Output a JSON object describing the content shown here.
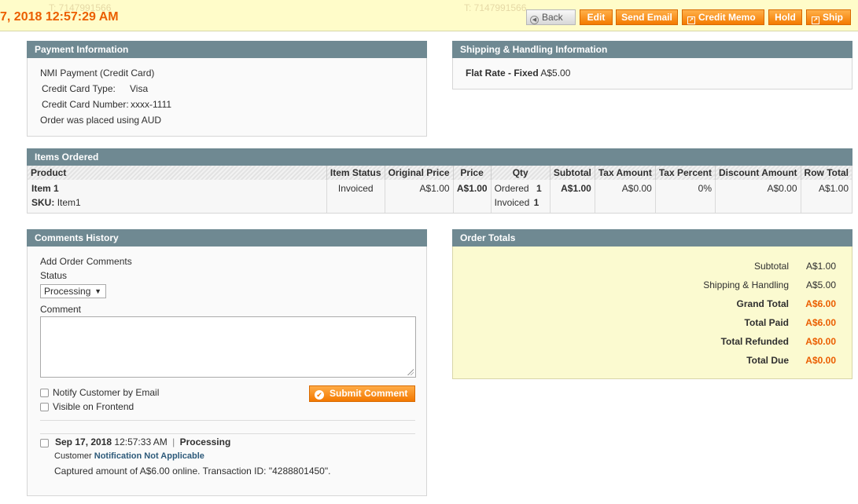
{
  "header": {
    "ghost_phone_left": "T: 7147991566",
    "ghost_phone_right": "T: 7147991566",
    "title": "7, 2018 12:57:29 AM",
    "buttons": {
      "back": "Back",
      "edit": "Edit",
      "send_email": "Send Email",
      "credit_memo": "Credit Memo",
      "hold": "Hold",
      "ship": "Ship"
    }
  },
  "payment": {
    "title": "Payment Information",
    "method": "NMI Payment (Credit Card)",
    "card_type_label": "Credit Card Type:",
    "card_type_value": "Visa",
    "card_number_label": "Credit Card Number:",
    "card_number_value": "xxxx-1111",
    "currency_note": "Order was placed using AUD"
  },
  "shipping": {
    "title": "Shipping & Handling Information",
    "method": "Flat Rate - Fixed",
    "amount": "A$5.00"
  },
  "items": {
    "title": "Items Ordered",
    "columns": [
      "Product",
      "Item Status",
      "Original Price",
      "Price",
      "Qty",
      "Subtotal",
      "Tax Amount",
      "Tax Percent",
      "Discount Amount",
      "Row Total"
    ],
    "rows": [
      {
        "name": "Item 1",
        "sku_label": "SKU:",
        "sku": "Item1",
        "status": "Invoiced",
        "original_price": "A$1.00",
        "price": "A$1.00",
        "qty_ordered_label": "Ordered",
        "qty_ordered": "1",
        "qty_invoiced_label": "Invoiced",
        "qty_invoiced": "1",
        "subtotal": "A$1.00",
        "tax_amount": "A$0.00",
        "tax_percent": "0%",
        "discount": "A$0.00",
        "row_total": "A$1.00"
      }
    ]
  },
  "comments": {
    "title": "Comments History",
    "add_label": "Add Order Comments",
    "status_label": "Status",
    "status_value": "Processing",
    "comment_label": "Comment",
    "notify_label": "Notify Customer by Email",
    "visible_label": "Visible on Frontend",
    "submit_label": "Submit Comment",
    "history": [
      {
        "date": "Sep 17, 2018",
        "time": "12:57:33 AM",
        "separator": "|",
        "status": "Processing",
        "customer_label": "Customer",
        "notification": "Notification Not Applicable",
        "message": "Captured amount of A$6.00 online. Transaction ID: \"4288801450\"."
      }
    ]
  },
  "totals": {
    "title": "Order Totals",
    "rows": [
      {
        "label": "Subtotal",
        "value": "A$1.00"
      },
      {
        "label": "Shipping & Handling",
        "value": "A$5.00"
      },
      {
        "label": "Grand Total",
        "value": "A$6.00"
      },
      {
        "label": "Total Paid",
        "value": "A$6.00"
      },
      {
        "label": "Total Refunded",
        "value": "A$0.00"
      },
      {
        "label": "Total Due",
        "value": "A$0.00"
      }
    ]
  },
  "colors": {
    "accent_orange": "#eb5e00",
    "header_bg": "#fffcc9",
    "section_head": "#6f8992",
    "totals_bg": "#fbfad0"
  }
}
